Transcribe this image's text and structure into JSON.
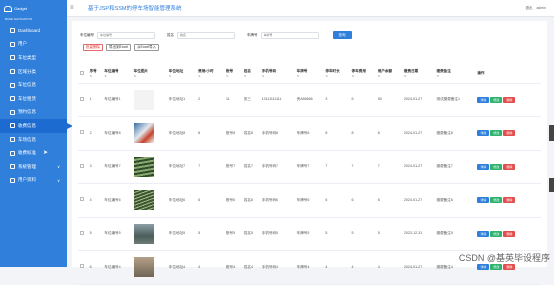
{
  "brand": {
    "logo_text": "Gadget",
    "subtitle": "BASE NAVIGATION"
  },
  "sidebar": {
    "items": [
      {
        "label": "Dashboard",
        "icon": "dashboard-icon"
      },
      {
        "label": "用户",
        "icon": "user-icon"
      },
      {
        "label": "车位类型",
        "icon": "parking-type-icon"
      },
      {
        "label": "区域分类",
        "icon": "area-icon"
      },
      {
        "label": "车位信息",
        "icon": "parking-info-icon"
      },
      {
        "label": "车位租赁",
        "icon": "rent-icon"
      },
      {
        "label": "预约信息",
        "icon": "reserve-icon"
      },
      {
        "label": "收费信息",
        "icon": "fee-icon",
        "active": true
      },
      {
        "label": "车场信息",
        "icon": "lot-icon"
      },
      {
        "label": "收费标准",
        "icon": "standard-icon"
      },
      {
        "label": "系统管理",
        "icon": "system-icon",
        "chevron": "∨"
      },
      {
        "label": "用户资料",
        "icon": "profile-icon",
        "chevron": "∨"
      }
    ]
  },
  "topbar": {
    "title": "基于JSP和SSM的停车场智能管理系统",
    "right1": "退出",
    "right2": "admin"
  },
  "search": {
    "f1_label": "车位编号",
    "f1_ph": "车位编号",
    "f2_label": "姓名",
    "f2_ph": "姓名",
    "f3_label": "车牌号",
    "f3_ph": "车牌号",
    "button": "查询"
  },
  "actions": {
    "delete": "批量删除",
    "export": "导出到Excel",
    "import": "从Excel导入"
  },
  "table": {
    "headers": [
      "序号",
      "车位编号",
      "车位图片",
      "车位地址",
      "费用/小时",
      "账号",
      "姓名",
      "手机号码",
      "车牌号",
      "停车时长",
      "停车费用",
      "用户余额",
      "缴费日期",
      "缴费备注",
      "操作"
    ],
    "rows": [
      {
        "no": "1",
        "code": "车位编号1",
        "addr": "车位地址1",
        "fee": "2",
        "acc": "11",
        "name": "张三",
        "phone": "13111111111",
        "plate": "贵A66666",
        "hours": "3",
        "cost": "6",
        "bal": "50",
        "date": "2024-01-27",
        "note": "测试缴费备注1",
        "pic": "pic1"
      },
      {
        "no": "2",
        "code": "车位编号8",
        "addr": "车位地址8",
        "fee": "8",
        "acc": "账号8",
        "name": "姓名8",
        "phone": "手机号码8",
        "plate": "车牌号8",
        "hours": "8",
        "cost": "8",
        "bal": "8",
        "date": "2024-01-27",
        "note": "缴费备注8",
        "pic": "pic2"
      },
      {
        "no": "3",
        "code": "车位编号7",
        "addr": "车位地址7",
        "fee": "7",
        "acc": "账号7",
        "name": "姓名7",
        "phone": "手机号码7",
        "plate": "车牌号7",
        "hours": "7",
        "cost": "7",
        "bal": "7",
        "date": "2024-01-27",
        "note": "缴费备注7",
        "pic": "pic3"
      },
      {
        "no": "4",
        "code": "车位编号6",
        "addr": "车位地址6",
        "fee": "6",
        "acc": "账号6",
        "name": "姓名6",
        "phone": "手机号码6",
        "plate": "车牌号6",
        "hours": "6",
        "cost": "6",
        "bal": "6",
        "date": "2024-01-27",
        "note": "缴费备注6",
        "pic": "pic4"
      },
      {
        "no": "5",
        "code": "车位编号5",
        "addr": "车位地址5",
        "fee": "5",
        "acc": "账号5",
        "name": "姓名5",
        "phone": "手机号码5",
        "plate": "车牌号5",
        "hours": "5",
        "cost": "5",
        "bal": "5",
        "date": "2023-12-31",
        "note": "缴费备注5",
        "pic": "pic5"
      },
      {
        "no": "6",
        "code": "车位编号4",
        "addr": "车位地址4",
        "fee": "4",
        "acc": "账号4",
        "name": "姓名4",
        "phone": "手机号码4",
        "plate": "车牌号4",
        "hours": "4",
        "cost": "4",
        "bal": "4",
        "date": "2024-01-27",
        "note": "缴费备注4",
        "pic": "pic6"
      }
    ],
    "ops": {
      "detail": "详情",
      "edit": "修改",
      "del": "删除"
    },
    "sort_glyph": "⇅"
  },
  "watermark": "CSDN @基英毕设程序",
  "colors": {
    "accent": "#2f7fdb",
    "success": "#2fb36e",
    "danger": "#e24d4d"
  }
}
